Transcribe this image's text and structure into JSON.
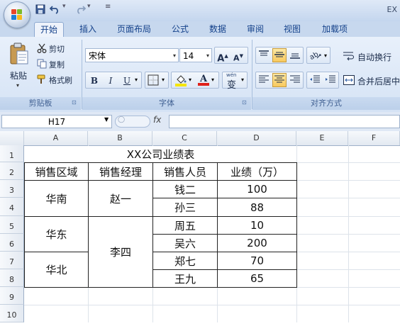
{
  "window": {
    "title": "EX"
  },
  "quick_access": {
    "save_icon": "save-icon",
    "undo_icon": "undo-icon",
    "redo_icon": "redo-icon"
  },
  "tabs": [
    "开始",
    "插入",
    "页面布局",
    "公式",
    "数据",
    "审阅",
    "视图",
    "加载项"
  ],
  "ribbon": {
    "clipboard": {
      "paste": "粘贴",
      "cut": "剪切",
      "copy": "复制",
      "format_painter": "格式刷",
      "caption": "剪贴板"
    },
    "font": {
      "name": "宋体",
      "size": "14",
      "bold": "B",
      "italic": "I",
      "underline": "U",
      "grow": "A",
      "shrink": "A",
      "phonetic": "wén",
      "phonetic_char": "变",
      "caption": "字体"
    },
    "alignment": {
      "wrap_text": "自动换行",
      "merge_center": "合并后居中",
      "caption": "对齐方式"
    },
    "colors": {
      "fill": "#f5e500",
      "font": "#e0211b"
    }
  },
  "formula_bar": {
    "name_box": "H17",
    "fx": "fx",
    "formula": ""
  },
  "columns": [
    "A",
    "B",
    "C",
    "D",
    "E",
    "F"
  ],
  "rows": [
    "1",
    "2",
    "3",
    "4",
    "5",
    "6",
    "7",
    "8",
    "9",
    "10"
  ],
  "sheet": {
    "title": "XX公司业绩表",
    "headers": [
      "销售区域",
      "销售经理",
      "销售人员",
      "业绩（万）"
    ],
    "regions": [
      "华南",
      "华东",
      "华北"
    ],
    "managers": [
      "赵一",
      "李四"
    ],
    "staff": [
      "钱二",
      "孙三",
      "周五",
      "吴六",
      "郑七",
      "王九"
    ],
    "sales": [
      "100",
      "88",
      "10",
      "200",
      "70",
      "65"
    ]
  }
}
